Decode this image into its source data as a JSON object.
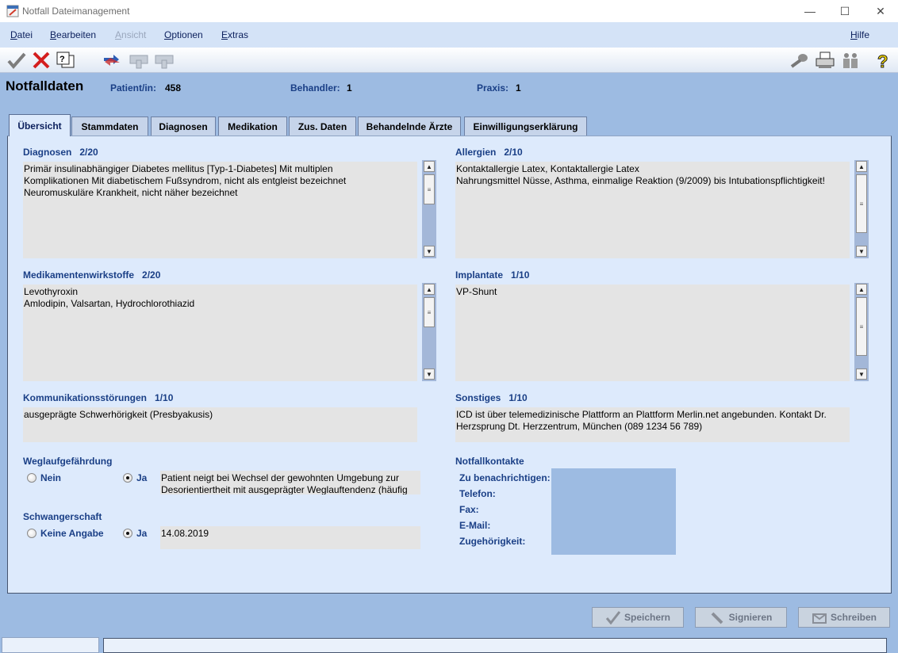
{
  "window": {
    "title": "Notfall Dateimanagement",
    "controls": {
      "minimize": "—",
      "maximize": "☐",
      "close": "✕"
    }
  },
  "menu": {
    "items": [
      {
        "label": "Datei",
        "mnemonic": "D",
        "rest": "atei",
        "enabled": true
      },
      {
        "label": "Bearbeiten",
        "mnemonic": "B",
        "rest": "earbeiten",
        "enabled": true
      },
      {
        "label": "Ansicht",
        "mnemonic": "A",
        "rest": "nsicht",
        "enabled": false
      },
      {
        "label": "Optionen",
        "mnemonic": "O",
        "rest": "ptionen",
        "enabled": true
      },
      {
        "label": "Extras",
        "mnemonic": "E",
        "rest": "xtras",
        "enabled": true
      },
      {
        "label": "Hilfe",
        "mnemonic": "H",
        "rest": "ilfe",
        "enabled": true
      }
    ]
  },
  "toolbar": {
    "left_icons": [
      "checkmark-icon",
      "red-x-icon",
      "help-document-icon",
      "transfer-icon",
      "title-card-icon",
      "card-icon"
    ],
    "right_icons": [
      "wrench-icon",
      "printer-icon",
      "people-icon",
      "question-icon"
    ]
  },
  "header": {
    "title": "Notfalldaten",
    "patient_label": "Patient/in:",
    "patient_value": "458",
    "behandler_label": "Behandler:",
    "behandler_value": "1",
    "praxis_label": "Praxis:",
    "praxis_value": "1"
  },
  "tabs": [
    {
      "label": "Übersicht",
      "active": true
    },
    {
      "label": "Stammdaten",
      "active": false
    },
    {
      "label": "Diagnosen",
      "active": false
    },
    {
      "label": "Medikation",
      "active": false
    },
    {
      "label": "Zus. Daten",
      "active": false
    },
    {
      "label": "Behandelnde Ärzte",
      "active": false
    },
    {
      "label": "Einwilligungserklärung",
      "active": false
    }
  ],
  "sections": {
    "diagnosen": {
      "label": "Diagnosen",
      "count": "2/20",
      "text": "Primär insulinabhängiger Diabetes mellitus [Typ-1-Diabetes] Mit multiplen\nKomplikationen Mit diabetischem Fußsyndrom, nicht als entgleist bezeichnet\nNeuromuskuläre Krankheit, nicht näher bezeichnet"
    },
    "allergien": {
      "label": "Allergien",
      "count": "2/10",
      "text": "Kontaktallergie Latex, Kontaktallergie Latex\nNahrungsmittel Nüsse, Asthma, einmalige Reaktion (9/2009) bis Intubationspflichtigkeit!"
    },
    "medikamente": {
      "label": "Medikamentenwirkstoffe",
      "count": "2/20",
      "text": "Levothyroxin\nAmlodipin, Valsartan, Hydrochlorothiazid"
    },
    "implantate": {
      "label": "Implantate",
      "count": "1/10",
      "text": "VP-Shunt"
    },
    "kommunikation": {
      "label": "Kommunikationsstörungen",
      "count": "1/10",
      "text": "ausgeprägte Schwerhörigkeit (Presbyakusis)"
    },
    "sonstiges": {
      "label": "Sonstiges",
      "count": "1/10",
      "text": "ICD ist über telemedizinische Plattform an Plattform Merlin.net angebunden. Kontakt Dr.\nHerzsprung Dt. Herzzentrum, München (089 1234 56 789)"
    },
    "weglauf": {
      "label": "Weglaufgefährdung",
      "option_no": "Nein",
      "option_yes": "Ja",
      "selected": "Ja",
      "text": "Patient neigt bei Wechsel der gewohnten Umgebung zur\nDesorientiertheit mit ausgeprägter Weglauftendenz (häufig"
    },
    "schwangerschaft": {
      "label": "Schwangerschaft",
      "option_no": "Keine Angabe",
      "option_yes": "Ja",
      "selected": "Ja",
      "date": "14.08.2019"
    },
    "notfallkontakte": {
      "label": "Notfallkontakte",
      "fields": [
        "Zu benachrichtigen:",
        "Telefon:",
        "Fax:",
        "E-Mail:",
        "Zugehörigkeit:"
      ]
    }
  },
  "buttons": {
    "save": "Speichern",
    "sign": "Signieren",
    "write": "Schreiben"
  }
}
